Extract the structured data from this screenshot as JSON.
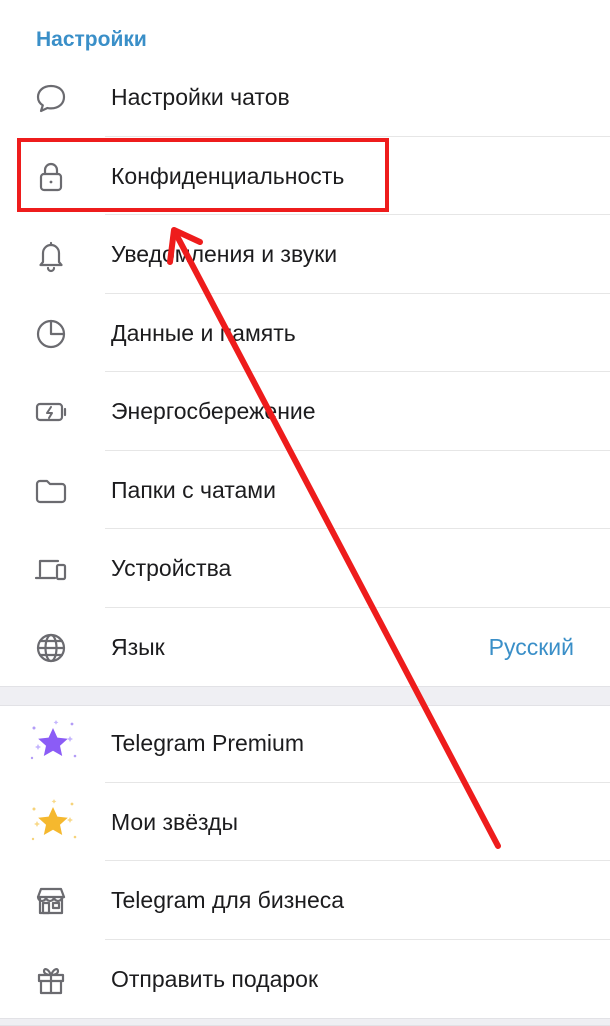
{
  "section_title": "Настройки",
  "items": [
    {
      "label": "Настройки чатов",
      "icon": "chat-bubble-icon"
    },
    {
      "label": "Конфиденциальность",
      "icon": "lock-icon"
    },
    {
      "label": "Уведомления и звуки",
      "icon": "bell-icon"
    },
    {
      "label": "Данные и память",
      "icon": "pie-chart-icon"
    },
    {
      "label": "Энергосбережение",
      "icon": "battery-bolt-icon"
    },
    {
      "label": "Папки с чатами",
      "icon": "folder-icon"
    },
    {
      "label": "Устройства",
      "icon": "devices-icon"
    },
    {
      "label": "Язык",
      "icon": "globe-icon",
      "value": "Русский"
    }
  ],
  "items2": [
    {
      "label": "Telegram Premium",
      "icon": "premium-star-icon"
    },
    {
      "label": "Мои звёзды",
      "icon": "gold-star-icon"
    },
    {
      "label": "Telegram для бизнеса",
      "icon": "shop-icon"
    },
    {
      "label": "Отправить подарок",
      "icon": "gift-icon"
    }
  ],
  "colors": {
    "accent": "#3a8fc8",
    "annotation": "#ee1c1c",
    "premium_star": "#8b5cf6",
    "gold_star": "#f5b82e"
  }
}
